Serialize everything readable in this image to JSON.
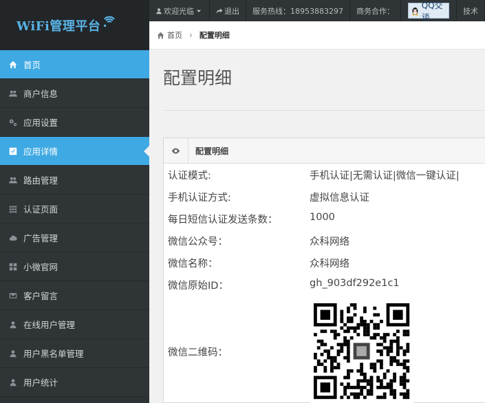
{
  "logo": {
    "text": "WiFi管理平台"
  },
  "sidebar": {
    "items": [
      {
        "label": "首页",
        "icon": "home-icon",
        "state": "active"
      },
      {
        "label": "商户信息",
        "icon": "users-icon"
      },
      {
        "label": "应用设置",
        "icon": "gears-icon"
      },
      {
        "label": "应用详情",
        "icon": "check-square-icon",
        "state": "selected"
      },
      {
        "label": "路由管理",
        "icon": "users-icon"
      },
      {
        "label": "认证页面",
        "icon": "grid-icon"
      },
      {
        "label": "广告管理",
        "icon": "cloud-icon"
      },
      {
        "label": "小微官网",
        "icon": "grid-icon"
      },
      {
        "label": "客户留言",
        "icon": "envelope-icon"
      },
      {
        "label": "在线用户管理",
        "icon": "user-icon"
      },
      {
        "label": "用户黑名单管理",
        "icon": "user-icon"
      },
      {
        "label": "用户统计",
        "icon": "user-icon"
      }
    ]
  },
  "topbar": {
    "welcome": "欢迎光临",
    "logout": "退出",
    "hotline": "服务热线：18953883297",
    "business": "商务合作：",
    "qq_label": "QQ交谈",
    "tech": "技术"
  },
  "breadcrumb": {
    "home": "首页",
    "current": "配置明细"
  },
  "page": {
    "title": "配置明细"
  },
  "panel": {
    "heading": "配置明细",
    "rows": [
      {
        "key": "认证模式:",
        "value": "手机认证|无需认证|微信一键认证|"
      },
      {
        "key": "手机认证方式:",
        "value": "虚拟信息认证"
      },
      {
        "key": "每日短信认证发送条数：",
        "value": "1000"
      },
      {
        "key": "微信公众号：",
        "value": "众科网络"
      },
      {
        "key": "微信名称：",
        "value": "众科网络"
      },
      {
        "key": "微信原始ID：",
        "value": "gh_903df292e1c1"
      }
    ],
    "qr_label": "微信二维码："
  },
  "colors": {
    "accent": "#3fa9e3",
    "sidebar": "#2d3234",
    "logo_text": "#5ab4e6"
  }
}
